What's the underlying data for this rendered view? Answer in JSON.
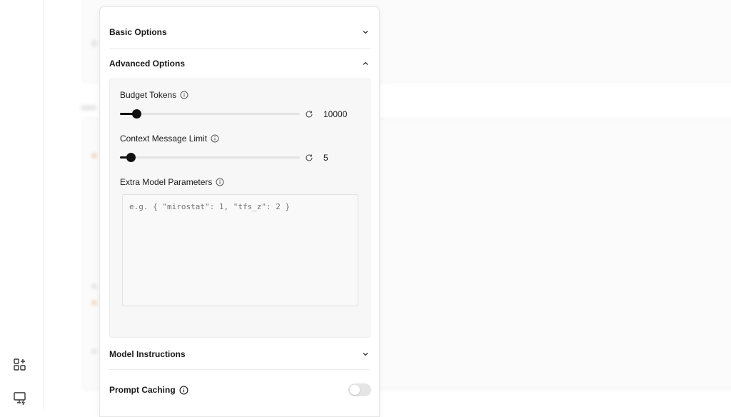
{
  "rail": {
    "icons": [
      "apps-add-icon",
      "screen-share-icon"
    ]
  },
  "panel": {
    "basic_options": {
      "label": "Basic Options",
      "state": "collapsed"
    },
    "advanced_options": {
      "label": "Advanced Options",
      "state": "expanded",
      "budget_tokens": {
        "label": "Budget Tokens",
        "value": "10000",
        "fill_fraction": 0.09
      },
      "context_message_limit": {
        "label": "Context Message Limit",
        "value": "5",
        "fill_fraction": 0.06
      },
      "extra_model_parameters": {
        "label": "Extra Model Parameters",
        "placeholder": "e.g. { \"mirostat\": 1, \"tfs_z\": 2 }"
      }
    },
    "model_instructions": {
      "label": "Model Instructions",
      "state": "collapsed"
    },
    "prompt_caching": {
      "label": "Prompt Caching",
      "enabled": false
    }
  },
  "colors": {
    "accent": "#111111",
    "track": "#e3e3e3",
    "toggle_off": "#e5e5e5"
  }
}
